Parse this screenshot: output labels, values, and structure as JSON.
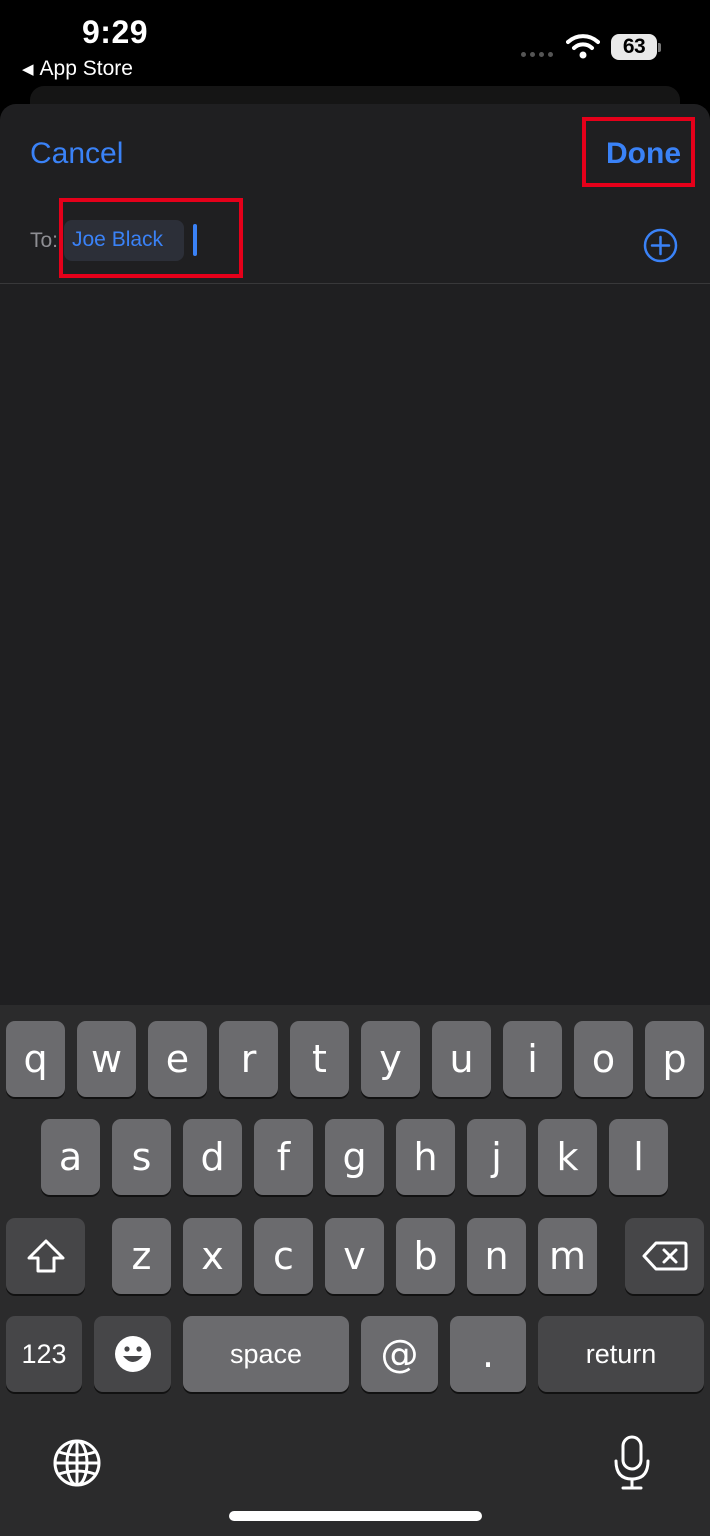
{
  "status_bar": {
    "time": "9:29",
    "back_label": "App Store",
    "battery": "63"
  },
  "compose": {
    "cancel_label": "Cancel",
    "done_label": "Done",
    "to_label": "To:",
    "recipient": "Joe Black"
  },
  "keyboard": {
    "row1": [
      "q",
      "w",
      "e",
      "r",
      "t",
      "y",
      "u",
      "i",
      "o",
      "p"
    ],
    "row2": [
      "a",
      "s",
      "d",
      "f",
      "g",
      "h",
      "j",
      "k",
      "l"
    ],
    "row3": [
      "z",
      "x",
      "c",
      "v",
      "b",
      "n",
      "m"
    ],
    "numbers_label": "123",
    "space_label": "space",
    "at_label": "@",
    "period_label": ".",
    "return_label": "return"
  },
  "colors": {
    "accent": "#3a82f7",
    "highlight": "#e5001a",
    "sheet_bg": "#1f1f21",
    "key_bg": "#6b6b6e",
    "key_dark_bg": "#464648"
  },
  "icons": [
    "back-arrow-icon",
    "cellular-signal-icon",
    "wifi-icon",
    "battery-icon",
    "add-contact-icon",
    "shift-icon",
    "delete-icon",
    "emoji-icon",
    "globe-icon",
    "microphone-icon"
  ]
}
